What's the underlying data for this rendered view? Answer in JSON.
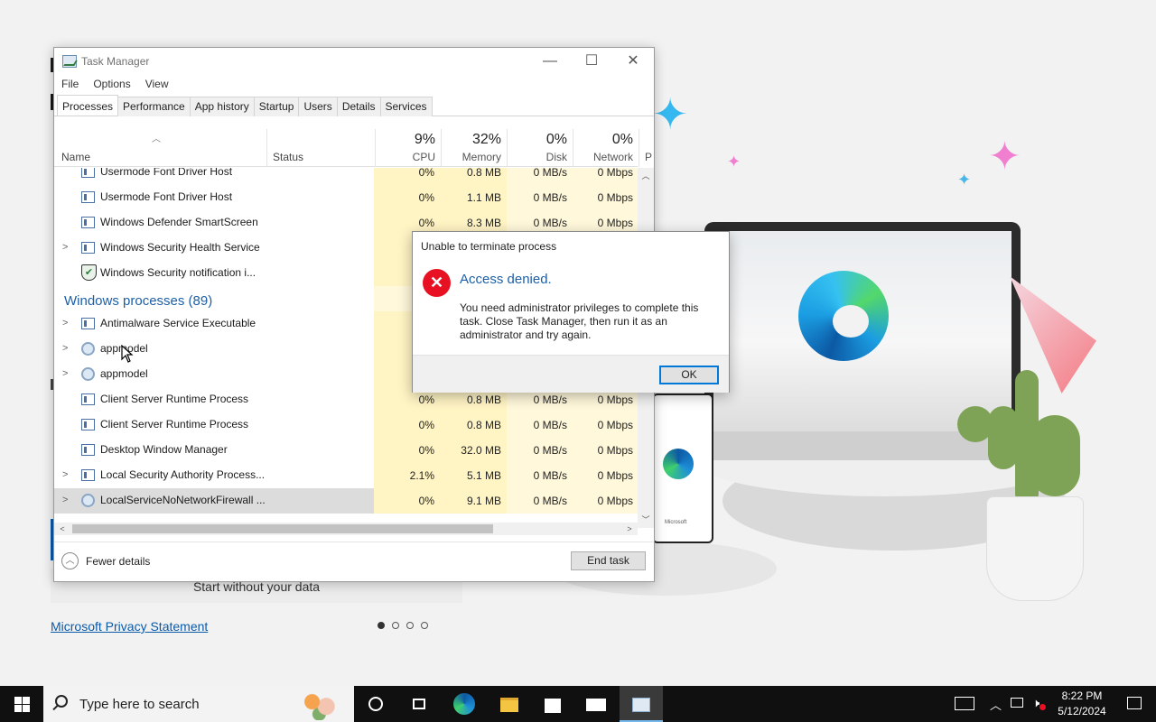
{
  "background": {
    "start_without_data": "Start without your data",
    "privacy_link": "Microsoft Privacy Statement",
    "phone_brand": "Microsoft"
  },
  "task_manager": {
    "title": "Task Manager",
    "menu": [
      "File",
      "Options",
      "View"
    ],
    "tabs": [
      "Processes",
      "Performance",
      "App history",
      "Startup",
      "Users",
      "Details",
      "Services"
    ],
    "active_tab": "Processes",
    "columns": {
      "name": "Name",
      "status": "Status",
      "cpu": {
        "pct": "9%",
        "label": "CPU"
      },
      "memory": {
        "pct": "32%",
        "label": "Memory"
      },
      "disk": {
        "pct": "0%",
        "label": "Disk"
      },
      "network": {
        "pct": "0%",
        "label": "Network"
      },
      "power_partial": "P"
    },
    "rows": [
      {
        "name": "Usermode Font Driver Host",
        "expandable": false,
        "icon": "window-icon",
        "cpu": "0%",
        "mem": "0.8 MB",
        "disk": "0 MB/s",
        "net": "0 Mbps"
      },
      {
        "name": "Usermode Font Driver Host",
        "expandable": false,
        "icon": "window-icon",
        "cpu": "0%",
        "mem": "1.1 MB",
        "disk": "0 MB/s",
        "net": "0 Mbps"
      },
      {
        "name": "Windows Defender SmartScreen",
        "expandable": false,
        "icon": "window-icon",
        "cpu": "0%",
        "mem": "8.3 MB",
        "disk": "0 MB/s",
        "net": "0 Mbps"
      },
      {
        "name": "Windows Security Health Service",
        "expandable": true,
        "icon": "window-icon",
        "cpu": "",
        "mem": "",
        "disk": "",
        "net": ""
      },
      {
        "name": "Windows Security notification i...",
        "expandable": false,
        "icon": "shield-icon",
        "cpu": "",
        "mem": "",
        "disk": "",
        "net": ""
      },
      {
        "group": "Windows processes (89)"
      },
      {
        "name": "Antimalware Service Executable",
        "expandable": true,
        "icon": "window-icon",
        "cpu": "",
        "mem": "",
        "disk": "",
        "net": ""
      },
      {
        "name": "appmodel",
        "expandable": true,
        "icon": "gear-icon",
        "cpu": "",
        "mem": "",
        "disk": "",
        "net": ""
      },
      {
        "name": "appmodel",
        "expandable": true,
        "icon": "gear-icon",
        "cpu": "",
        "mem": "",
        "disk": "",
        "net": ""
      },
      {
        "name": "Client Server Runtime Process",
        "expandable": false,
        "icon": "window-icon",
        "cpu": "0%",
        "mem": "0.8 MB",
        "disk": "0 MB/s",
        "net": "0 Mbps"
      },
      {
        "name": "Client Server Runtime Process",
        "expandable": false,
        "icon": "window-icon",
        "cpu": "0%",
        "mem": "0.8 MB",
        "disk": "0 MB/s",
        "net": "0 Mbps"
      },
      {
        "name": "Desktop Window Manager",
        "expandable": false,
        "icon": "window-icon",
        "cpu": "0%",
        "mem": "32.0 MB",
        "disk": "0 MB/s",
        "net": "0 Mbps"
      },
      {
        "name": "Local Security Authority Process...",
        "expandable": true,
        "icon": "window-icon",
        "cpu": "2.1%",
        "mem": "5.1 MB",
        "disk": "0 MB/s",
        "net": "0 Mbps"
      },
      {
        "name": "LocalServiceNoNetworkFirewall ...",
        "expandable": true,
        "icon": "gear-icon",
        "cpu": "0%",
        "mem": "9.1 MB",
        "disk": "0 MB/s",
        "net": "0 Mbps",
        "selected": true
      }
    ],
    "fewer_details": "Fewer details",
    "end_task": "End task"
  },
  "dialog": {
    "title": "Unable to terminate process",
    "main_instruction": "Access denied.",
    "content": "You need administrator privileges to complete this task. Close Task Manager, then run it as an administrator and try again.",
    "ok": "OK",
    "icon": "error-icon"
  },
  "taskbar": {
    "search_placeholder": "Type here to search",
    "time": "8:22 PM",
    "date": "5/12/2024"
  }
}
